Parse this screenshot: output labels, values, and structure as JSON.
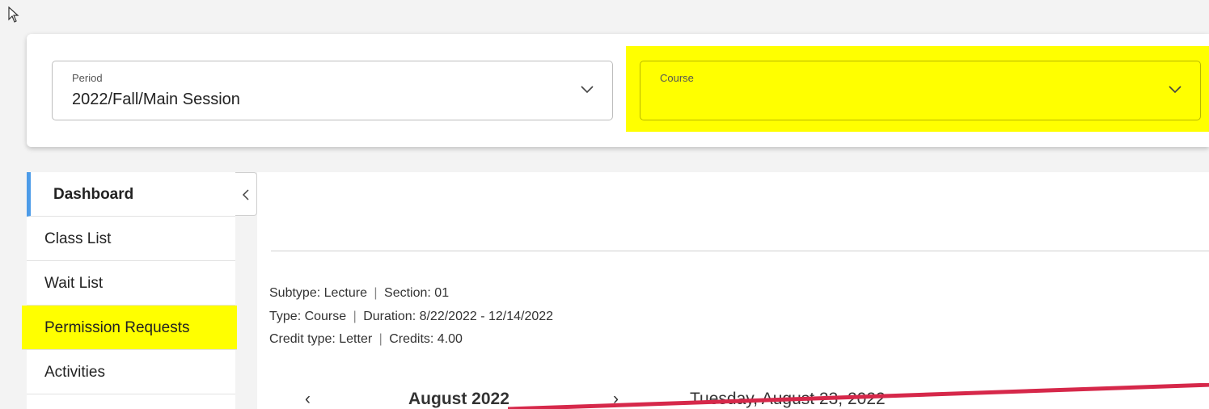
{
  "filters": {
    "period": {
      "label": "Period",
      "value": "2022/Fall/Main Session"
    },
    "course": {
      "label": "Course",
      "value": ""
    }
  },
  "sidebar": {
    "items": [
      {
        "label": "Dashboard"
      },
      {
        "label": "Class List"
      },
      {
        "label": "Wait List"
      },
      {
        "label": "Permission Requests"
      },
      {
        "label": "Activities"
      }
    ]
  },
  "course_info": {
    "subtype_label": "Subtype: Lecture",
    "section_label": "Section: 01",
    "type_label": "Type: Course",
    "duration_label": "Duration: 8/22/2022 - 12/14/2022",
    "credit_type_label": "Credit type: Letter",
    "credits_label": "Credits: 4.00",
    "separator": "|"
  },
  "calendar": {
    "prev_glyph": "‹",
    "month": "August 2022",
    "next_glyph": "›",
    "selected_date": "Tuesday, August 23, 2022"
  },
  "colors": {
    "highlight": "#ffff00",
    "active_accent": "#4c9be8",
    "annotation_line": "#d6284a"
  },
  "icons": {
    "cursor": "mouse-pointer-icon",
    "dropdown": "chevron-down-icon",
    "collapse": "chevron-left-icon"
  }
}
